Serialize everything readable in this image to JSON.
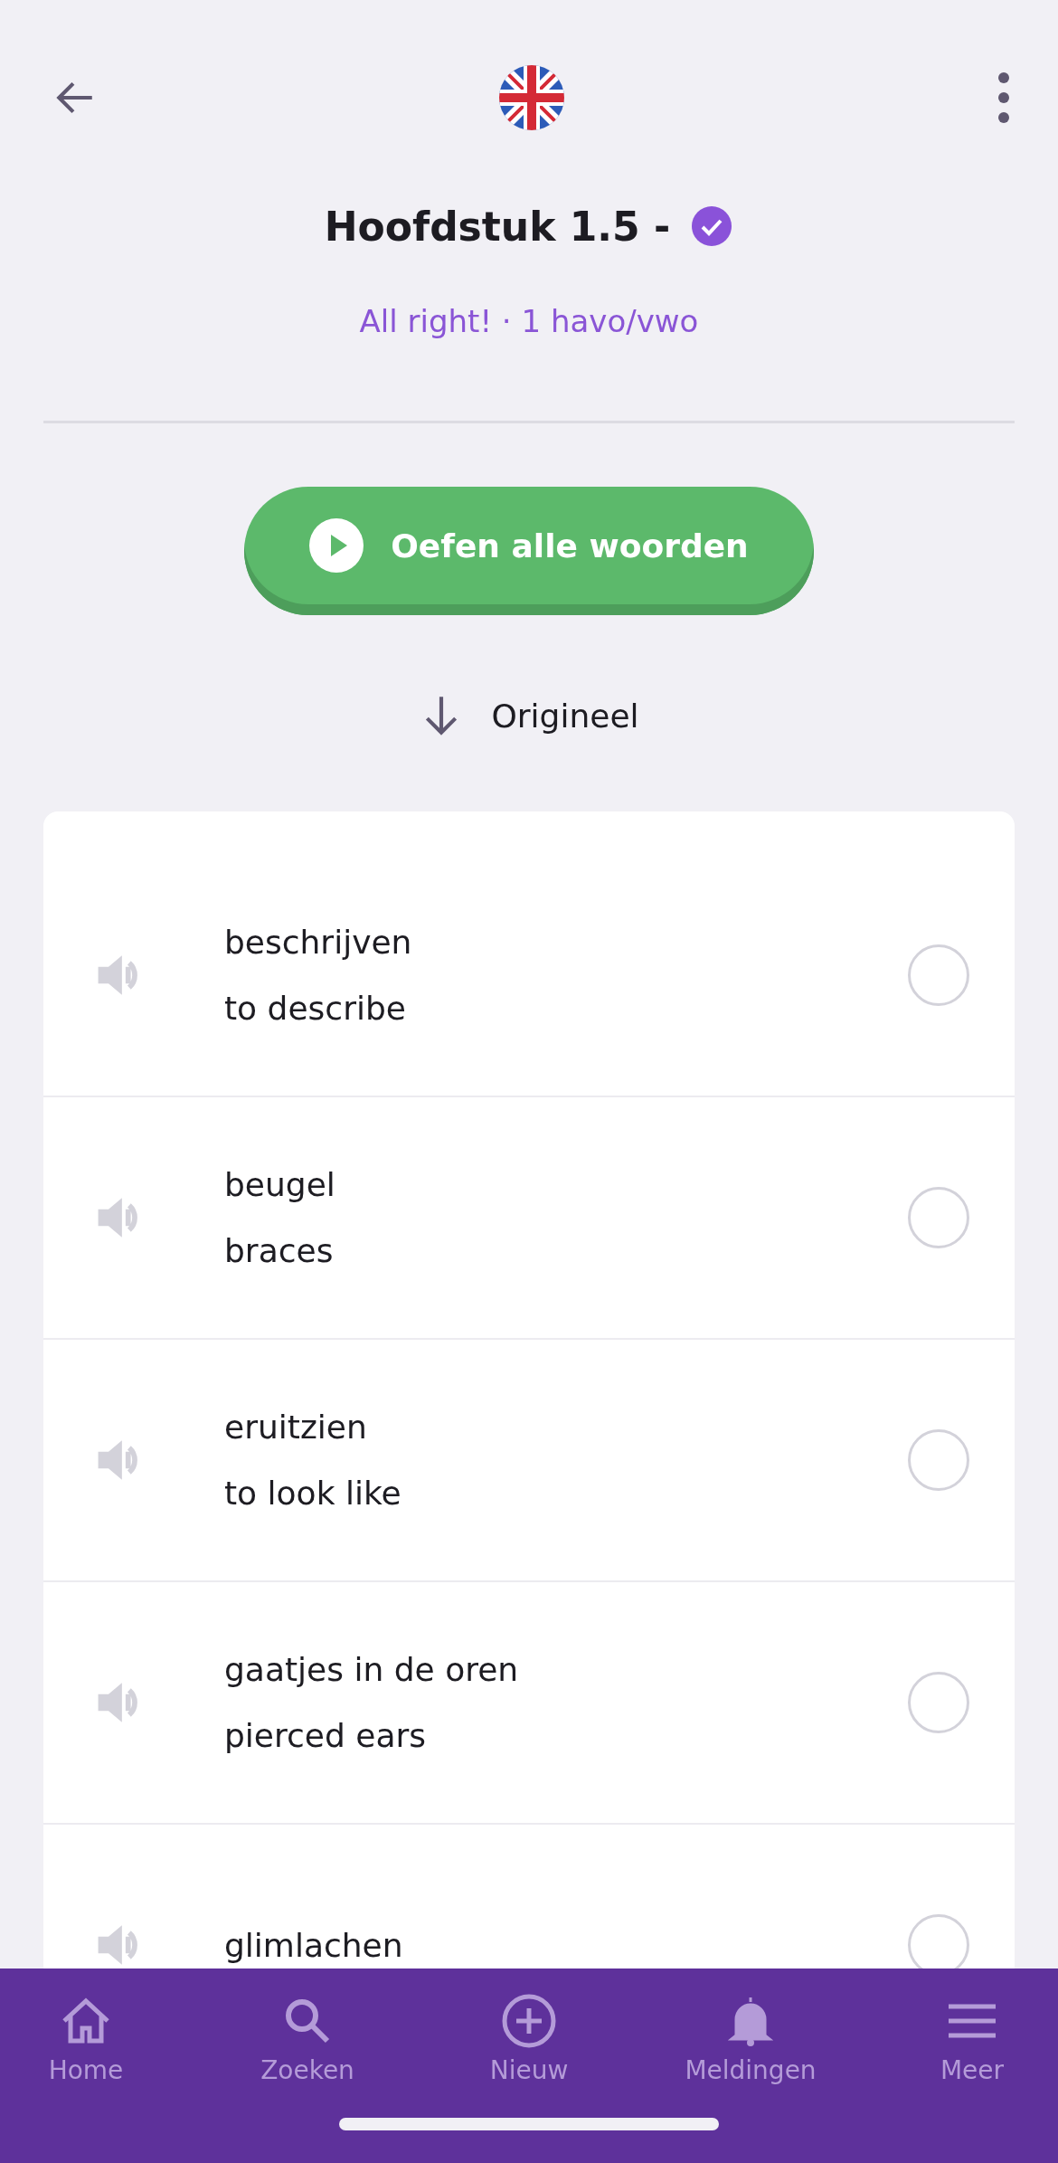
{
  "header": {
    "title": "Hoofdstuk 1.5 -",
    "verified": true,
    "subtitle": "All right! · 1 havo/vwo"
  },
  "practice_button": {
    "label": "Oefen alle woorden"
  },
  "sort": {
    "label": "Origineel"
  },
  "words": [
    {
      "word": "beschrijven",
      "translation": "to describe",
      "checked": false
    },
    {
      "word": "beugel",
      "translation": "braces",
      "checked": false
    },
    {
      "word": "eruitzien",
      "translation": "to look like",
      "checked": false
    },
    {
      "word": "gaatjes in de oren",
      "translation": "pierced ears",
      "checked": false
    },
    {
      "word": "glimlachen",
      "checked": false
    }
  ],
  "nav": [
    {
      "label": "Home",
      "kind": "home"
    },
    {
      "label": "Zoeken",
      "kind": "search"
    },
    {
      "label": "Nieuw",
      "kind": "new"
    },
    {
      "label": "Meldingen",
      "kind": "notifications"
    },
    {
      "label": "Meer",
      "kind": "more"
    }
  ]
}
